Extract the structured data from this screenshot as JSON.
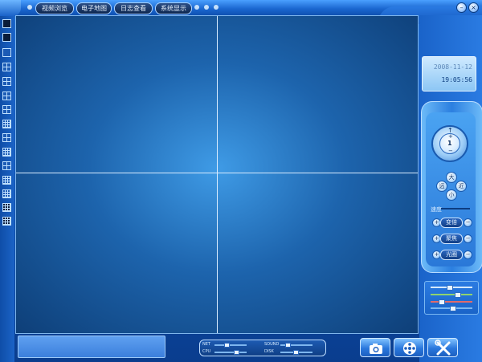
{
  "nav": {
    "tabs": [
      {
        "label": "视频浏览"
      },
      {
        "label": "电子地图"
      },
      {
        "label": "日志查看"
      },
      {
        "label": "系统显示"
      }
    ]
  },
  "window": {
    "minimize": "–",
    "close": "×"
  },
  "clock": {
    "date": "2008-11-12",
    "time": "19:05:56"
  },
  "ptz": {
    "up": "↑",
    "center": "1",
    "plus": "+",
    "minus": "−",
    "left": "远",
    "right": "近",
    "focus_a": "大",
    "focus_b": "小",
    "speed_label": "速度",
    "lens": [
      {
        "label": "变倍"
      },
      {
        "label": "聚焦"
      },
      {
        "label": "光圈"
      }
    ]
  },
  "meters": {
    "net": "NET",
    "sound": "SOUND",
    "cpu": "CPU",
    "disk": "DISK"
  },
  "buttons": {
    "snapshot": "camera-icon",
    "record": "film-reel-icon",
    "settings": "tools-icon"
  },
  "colors": {
    "accent": "#1a66cf",
    "panel": "#2a7be2",
    "grid_line": "#d9ecff"
  }
}
